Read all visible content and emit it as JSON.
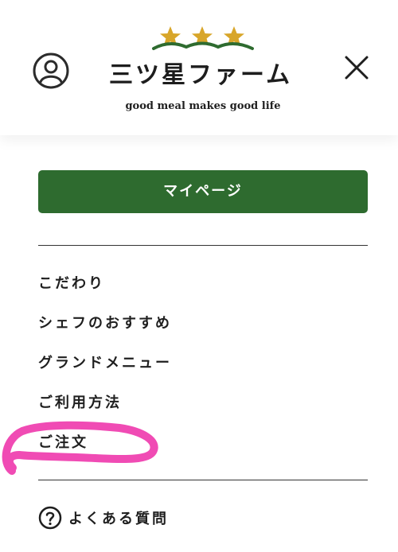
{
  "header": {
    "brand_name": "三ツ星ファーム",
    "tagline": "good meal makes good life",
    "account_icon": "user-circle-icon",
    "close_icon": "close-icon",
    "logo_icon": "three-stars-logo-icon",
    "star_color": "#d8a62a",
    "wave_color": "#2e6b2f"
  },
  "mypage_button": {
    "label": "マイページ",
    "color": "#2e6b2f"
  },
  "menu": {
    "items": [
      {
        "label": "こだわり"
      },
      {
        "label": "シェフのおすすめ"
      },
      {
        "label": "グランドメニュー"
      },
      {
        "label": "ご利用方法"
      },
      {
        "label": "ご注文"
      }
    ]
  },
  "annotation": {
    "color": "#f04bb4",
    "icon": "pink-highlight-stroke"
  },
  "faq": {
    "icon": "question-circle-icon",
    "label": "よくある質問"
  }
}
